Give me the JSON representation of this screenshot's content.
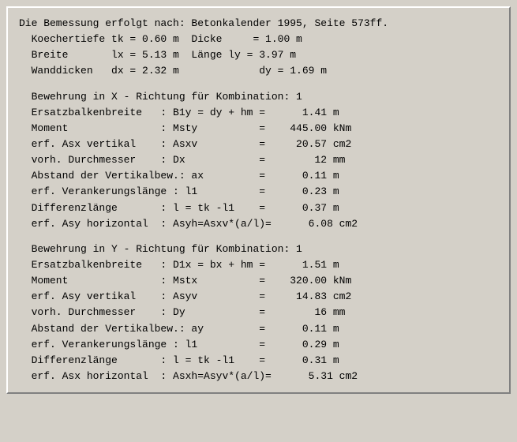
{
  "content": {
    "header": "Die Bemessung erfolgt nach: Betonkalender 1995, Seite 573ff.",
    "lines": [
      {
        "id": "koechertiefe",
        "text": "  Koechertiefe tk = 0.60 m  Dicke     = 1.00 m"
      },
      {
        "id": "breite",
        "text": "  Breite       lx = 5.13 m  Länge ly = 3.97 m"
      },
      {
        "id": "wanddicken",
        "text": "  Wanddicken   dx = 2.32 m             dy = 1.69 m"
      }
    ],
    "sectionX": {
      "heading": "  Bewehrung in X - Richtung für Kombination: 1",
      "rows": [
        {
          "label": "  Ersatzbalkenbreite   : B1y = dy + hm =",
          "value": "      1.41 m"
        },
        {
          "label": "  Moment               : Msty          =",
          "value": "    445.00 kNm"
        },
        {
          "label": "  erf. Asx vertikal    : Asxv          =",
          "value": "     20.57 cm2"
        },
        {
          "label": "  vorh. Durchmesser    : Dx            =",
          "value": "        12 mm"
        },
        {
          "label": "  Abstand der Vertikalbew.: ax         =",
          "value": "      0.11 m"
        },
        {
          "label": "  erf. Verankerungslänge : l1          =",
          "value": "      0.23 m"
        },
        {
          "label": "  Differenzlänge       : l = tk -l1    =",
          "value": "      0.37 m"
        },
        {
          "label": "  erf. Asy horizontal  : Asyh=Asxv*(a/l)=",
          "value": "      6.08 cm2"
        }
      ]
    },
    "sectionY": {
      "heading": "  Bewehrung in Y - Richtung für Kombination: 1",
      "rows": [
        {
          "label": "  Ersatzbalkenbreite   : D1x = bx + hm =",
          "value": "      1.51 m"
        },
        {
          "label": "  Moment               : Mstx          =",
          "value": "    320.00 kNm"
        },
        {
          "label": "  erf. Asy vertikal    : Asyv          =",
          "value": "     14.83 cm2"
        },
        {
          "label": "  vorh. Durchmesser    : Dy            =",
          "value": "        16 mm"
        },
        {
          "label": "  Abstand der Vertikalbew.: ay         =",
          "value": "      0.11 m"
        },
        {
          "label": "  erf. Verankerungslänge : l1          =",
          "value": "      0.29 m"
        },
        {
          "label": "  Differenzlänge       : l = tk -l1    =",
          "value": "      0.31 m"
        },
        {
          "label": "  erf. Asx horizontal  : Asxh=Asyv*(a/l)=",
          "value": "      5.31 cm2"
        }
      ]
    }
  }
}
